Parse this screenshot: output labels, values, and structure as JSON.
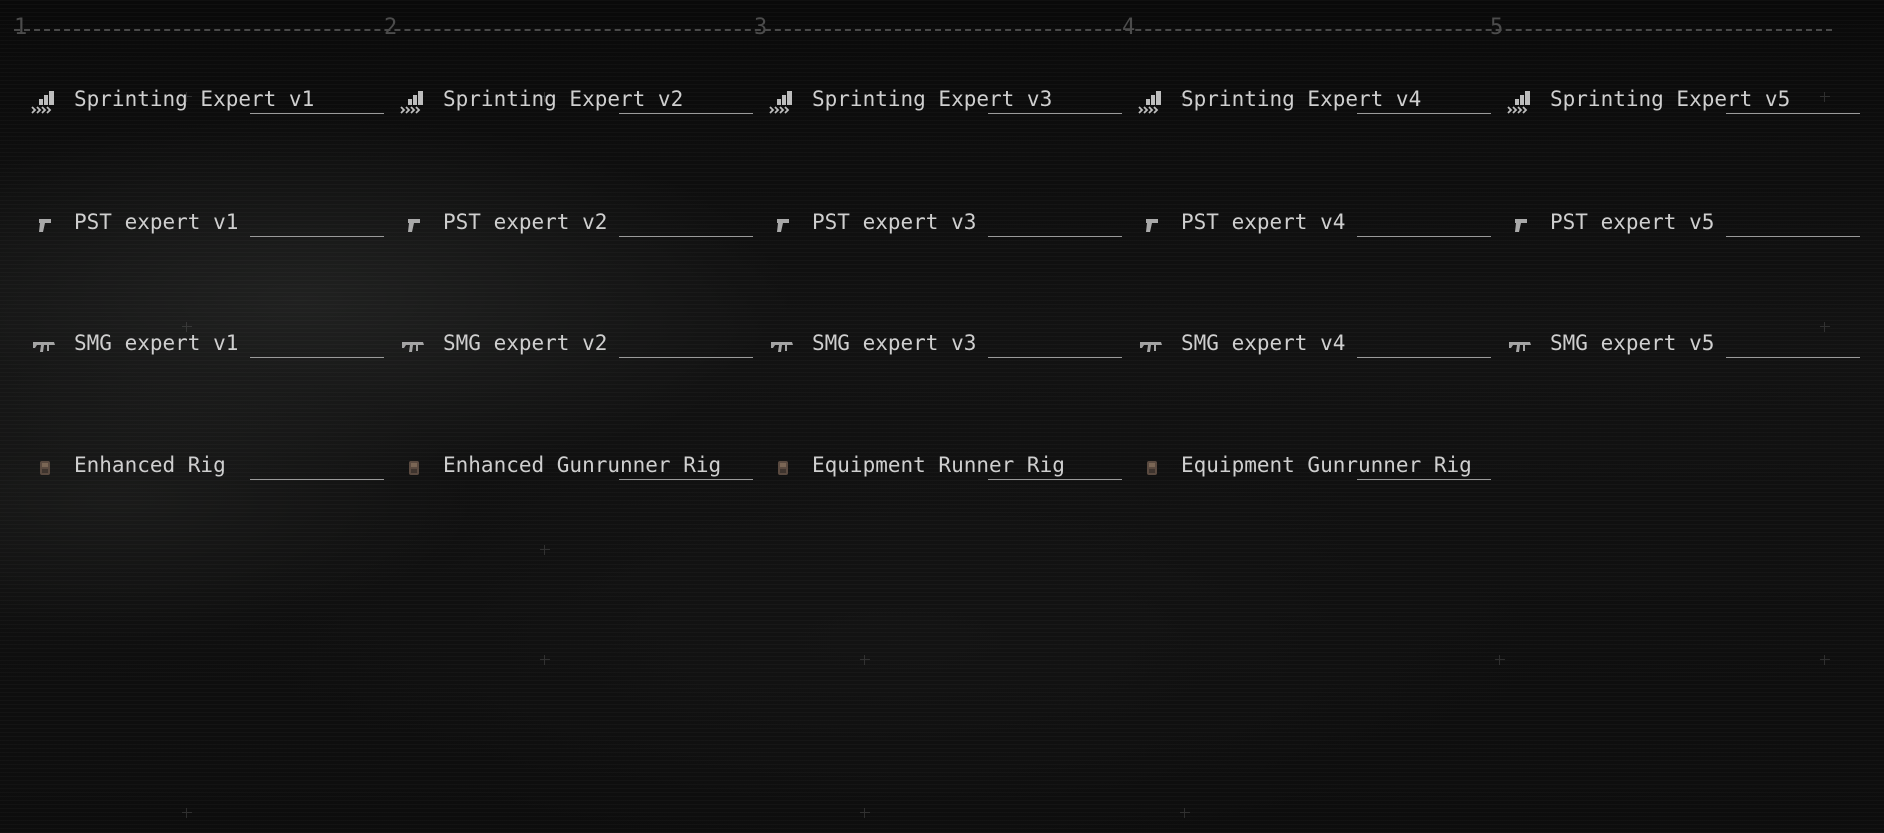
{
  "tiers": [
    "1",
    "2",
    "3",
    "4",
    "5"
  ],
  "rows": [
    {
      "icon": "sprint-icon",
      "skills": [
        "Sprinting Expert v1",
        "Sprinting Expert v2",
        "Sprinting Expert v3",
        "Sprinting Expert v4",
        "Sprinting Expert v5"
      ]
    },
    {
      "icon": "pistol-icon",
      "skills": [
        "PST expert v1",
        "PST expert v2",
        "PST expert v3",
        "PST expert v4",
        "PST expert v5"
      ]
    },
    {
      "icon": "smg-icon",
      "skills": [
        "SMG expert v1",
        "SMG expert v2",
        "SMG expert v3",
        "SMG expert v4",
        "SMG expert v5"
      ]
    },
    {
      "icon": "rig-icon",
      "skills": [
        "Enhanced Rig",
        "Enhanced Gunrunner Rig",
        "Equipment Runner Rig",
        "Equipment Gunrunner Rig"
      ]
    }
  ],
  "colors": {
    "text": "#cfcfcf",
    "ruler": "#4a4a4a",
    "underline": "#9a9a9a"
  }
}
